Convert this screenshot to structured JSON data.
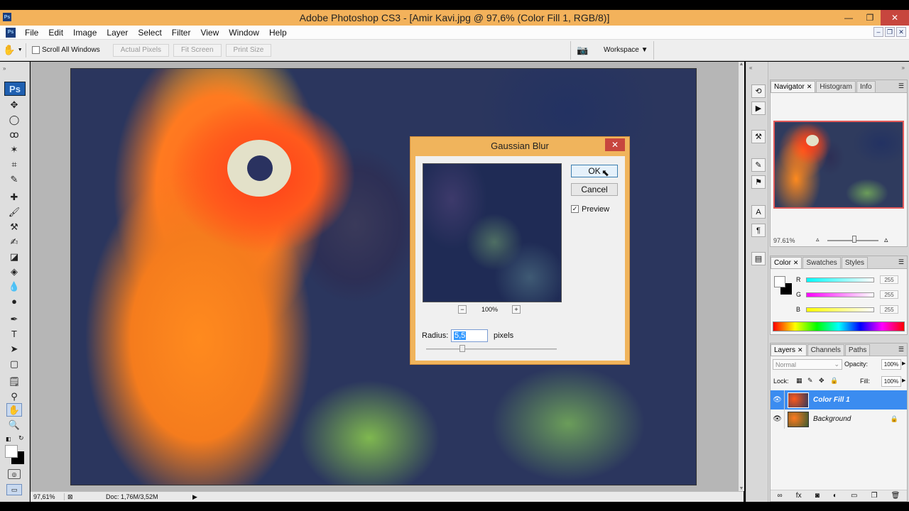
{
  "window": {
    "title": "Adobe Photoshop CS3 - [Amir Kavi.jpg @ 97,6% (Color Fill 1, RGB/8)]",
    "app_icon": "Ps"
  },
  "menu": [
    "File",
    "Edit",
    "Image",
    "Layer",
    "Select",
    "Filter",
    "View",
    "Window",
    "Help"
  ],
  "options_bar": {
    "scroll_all_windows": "Scroll All Windows",
    "actual_pixels": "Actual Pixels",
    "fit_screen": "Fit Screen",
    "print_size": "Print Size",
    "workspace": "Workspace ▼"
  },
  "toolbox": {
    "badge": "Ps"
  },
  "status": {
    "zoom": "97,61%",
    "doc": "Doc: 1,76M/3,52M"
  },
  "navigator": {
    "tabs": [
      "Navigator",
      "Histogram",
      "Info"
    ],
    "zoom": "97.61%"
  },
  "color_panel": {
    "tabs": [
      "Color",
      "Swatches",
      "Styles"
    ],
    "channels": [
      {
        "label": "R",
        "value": "255"
      },
      {
        "label": "G",
        "value": "255"
      },
      {
        "label": "B",
        "value": "255"
      }
    ]
  },
  "layers_panel": {
    "tabs": [
      "Layers",
      "Channels",
      "Paths"
    ],
    "blend_mode": "Normal",
    "opacity_label": "Opacity:",
    "opacity": "100%",
    "lock_label": "Lock:",
    "fill_label": "Fill:",
    "fill": "100%",
    "layers": [
      {
        "name": "Color Fill 1",
        "selected": true
      },
      {
        "name": "Background",
        "selected": false
      }
    ]
  },
  "dialog": {
    "title": "Gaussian Blur",
    "ok": "OK",
    "cancel": "Cancel",
    "preview_label": "Preview",
    "preview_checked": true,
    "zoom": "100%",
    "radius_label": "Radius:",
    "radius_value": "5,5",
    "radius_unit": "pixels",
    "minus": "−",
    "plus": "+"
  }
}
